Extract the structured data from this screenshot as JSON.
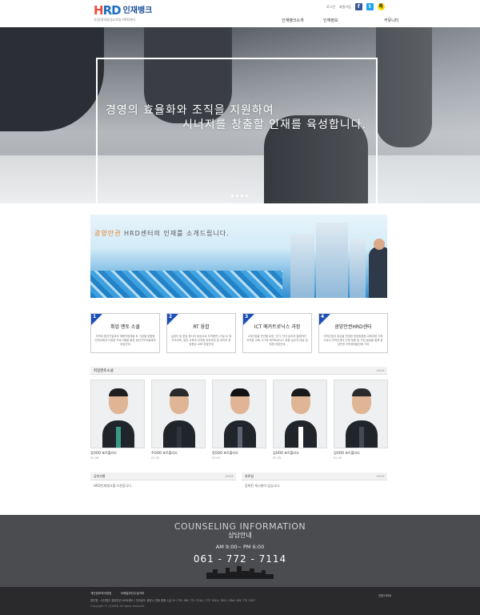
{
  "header": {
    "logo_mark_h": "H",
    "logo_mark_rest": "RD",
    "logo_kor": "인재뱅크",
    "logo_sub": "사)동명대평생교육원 HRD센터",
    "top_links": [
      "로그인",
      "회원가입"
    ],
    "sns": [
      {
        "name": "facebook",
        "glyph": "f"
      },
      {
        "name": "twitter",
        "glyph": "t"
      },
      {
        "name": "kakao",
        "glyph": "톡"
      }
    ],
    "nav": [
      "인재뱅크소개",
      "인재정보",
      "커뮤니티"
    ]
  },
  "hero": {
    "line1": "경영의 효율화와 조직을 지원하여",
    "line2": "시너지를 창출할 인재를 육성합니다."
  },
  "banner": {
    "highlight": "광양만권",
    "text": " HRD센터의 인재를 소개드립니다."
  },
  "cards": [
    {
      "num": "1",
      "title": "취업 멘토 소클",
      "desc": "지역내 중견기업과의 채용약정체결 후 기업별 맞춤형 인재교육과 다양한 프로그램을 통한 청년구직자들에게 취업연계"
    },
    {
      "num": "2",
      "title": "RT 융합",
      "desc": "실업자 및 현장 종사자 대상으로 자격증반 (기능사) 및 직무교육, 일반 교육과 자격증 취득과정 및 재직자 현장향상 교육 취업연계"
    },
    {
      "num": "3",
      "title": "ICT 메카트로닉스 과정",
      "desc": "4차산업을 견인할 로봇, 전기, 전자 분야의 통합적인 자격증 교육, ICT와 메카트로닉스 융합 실무자 대상 현장형 취업연계"
    },
    {
      "num": "4",
      "title": "광양만권HRD센터",
      "desc": "지역산업의 특성을 반영한 현장맞춤형 교육과정 기획으로서 지역인재의 인재 채용 및 기업 발굴을 통해 광양만권 지역경제발전에 기여"
    }
  ],
  "graduates": {
    "title": "취업멘토소클",
    "more": "MORE",
    "items": [
      {
        "name": "강OOO 포트폴리오",
        "date": "02-06",
        "tie": "#3a9a7e",
        "hair": "#1e1e1e"
      },
      {
        "name": "주OOO 포트폴리오",
        "date": "02-05",
        "tie": "#30353d",
        "hair": "#2a2a2a"
      },
      {
        "name": "장OOO 포트폴리오",
        "date": "02-05",
        "tie": "#5b6470",
        "hair": "#121212"
      },
      {
        "name": "김OOO 포트폴리오",
        "date": "02-05",
        "tie": "#ffffff",
        "hair": "#1a1a1a"
      },
      {
        "name": "김OOO 포트폴리오",
        "date": "02-05",
        "tie": "#444b55",
        "hair": "#2b2b2b"
      }
    ]
  },
  "notice": {
    "title": "공지사항",
    "more": "MORE",
    "item": "HRD인재뱅크를 오픈합니다."
  },
  "gallery": {
    "title": "자료실",
    "more": "MORE",
    "item": "등록된 게시물이 없습니다."
  },
  "counsel": {
    "en": "COUNSELING INFORMATION",
    "ko": "상담안내",
    "hours": "AM 9:00~ PM 6:00",
    "phone": "061 - 772 - 7114"
  },
  "footer": {
    "links": [
      "개인정보처리방침",
      "이메일무단수집거부"
    ],
    "address": "법인명 : 사단법인 광양만권 HRD센터 / 전라남도 광양시 인동 현황 1길 10 / TEL 061 772 7114 | 772 7414, 7421 / FAX. 061 772 7427",
    "copyright": "Copyright © (사)HRD All rights reserved.",
    "site": "관련사이트"
  }
}
